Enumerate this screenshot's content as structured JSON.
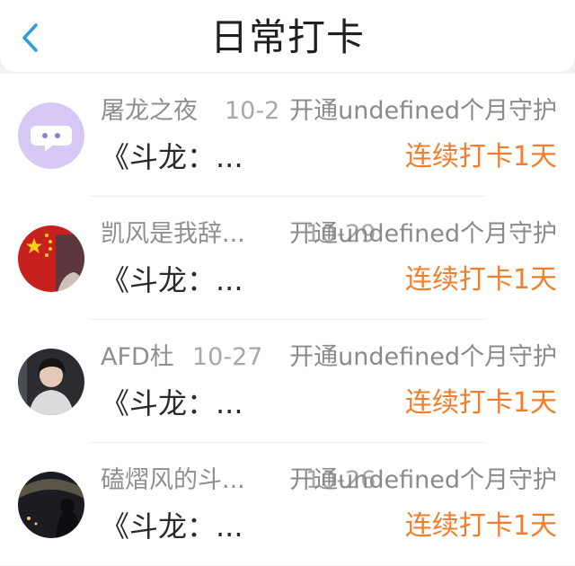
{
  "header": {
    "title": "日常打卡",
    "back_icon": "chevron-left-icon",
    "back_color": "#2d9be6"
  },
  "entries": [
    {
      "username": "屠龙之夜",
      "date": "10-2",
      "guard_text": "开通undefined个月守护",
      "post_title": "《斗龙：...",
      "streak": "连续打卡1天",
      "avatar": "purple-chat-bubble-avatar"
    },
    {
      "username": "凯风是我辞...",
      "date": "10-29",
      "guard_text": "开通undefined个月守护",
      "post_title": "《斗龙：...",
      "streak": "连续打卡1天",
      "avatar": "red-flag-avatar"
    },
    {
      "username": "AFD杜",
      "date": "10-27",
      "guard_text": "开通undefined个月守护",
      "post_title": "《斗龙：...",
      "streak": "连续打卡1天",
      "avatar": "portrait-photo-avatar"
    },
    {
      "username": "磕熠风的斗...",
      "date": "10-26",
      "guard_text": "开通undefined个月守护",
      "post_title": "《斗龙：...",
      "streak": "连续打卡1天",
      "avatar": "night-scene-avatar"
    }
  ],
  "colors": {
    "streak": "#f07e2c",
    "muted_text": "#8f8f8f",
    "title_text": "#1f1f1f"
  }
}
